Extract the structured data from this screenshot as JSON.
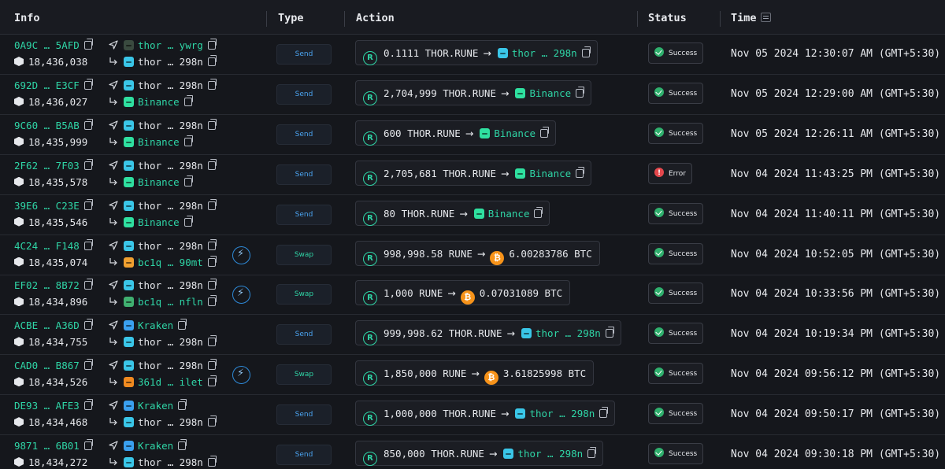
{
  "header": {
    "info": "Info",
    "type": "Type",
    "action": "Action",
    "status": "Status",
    "time": "Time"
  },
  "colors": {
    "accent": "#2fd5a6",
    "send": "#4aa3f0",
    "success": "#2fb06d",
    "error": "#e5484d",
    "btc": "#f7931a"
  },
  "rows": [
    {
      "hash": "0A9C … 5AFD",
      "block": "18,436,038",
      "from": "thor … ywrg",
      "from_color": "#3a4a3f",
      "from_style": "green",
      "to": "thor … 298n",
      "to_color": "#3ac6e8",
      "to_style": "white",
      "swap": false,
      "type": "Send",
      "amount": "0.1111 THOR.RUNE",
      "dest": "thor … 298n",
      "dest_color": "#3ac6e8",
      "dest_kind": "addr",
      "status": "Success",
      "time": "Nov 05 2024 12:30:07 AM (GMT+5:30)"
    },
    {
      "hash": "692D … E3CF",
      "block": "18,436,027",
      "from": "thor … 298n",
      "from_color": "#3ac6e8",
      "from_style": "white",
      "to": "Binance",
      "to_color": "#2fe0a0",
      "to_style": "green",
      "swap": false,
      "type": "Send",
      "amount": "2,704,999 THOR.RUNE",
      "dest": "Binance",
      "dest_color": "#2fe0a0",
      "dest_kind": "addr",
      "status": "Success",
      "time": "Nov 05 2024 12:29:00 AM (GMT+5:30)"
    },
    {
      "hash": "9C60 … B5AB",
      "block": "18,435,999",
      "from": "thor … 298n",
      "from_color": "#3ac6e8",
      "from_style": "white",
      "to": "Binance",
      "to_color": "#2fe0a0",
      "to_style": "green",
      "swap": false,
      "type": "Send",
      "amount": "600 THOR.RUNE",
      "dest": "Binance",
      "dest_color": "#2fe0a0",
      "dest_kind": "addr",
      "status": "Success",
      "time": "Nov 05 2024 12:26:11 AM (GMT+5:30)"
    },
    {
      "hash": "2F62 … 7F03",
      "block": "18,435,578",
      "from": "thor … 298n",
      "from_color": "#3ac6e8",
      "from_style": "white",
      "to": "Binance",
      "to_color": "#2fe0a0",
      "to_style": "green",
      "swap": false,
      "type": "Send",
      "amount": "2,705,681 THOR.RUNE",
      "dest": "Binance",
      "dest_color": "#2fe0a0",
      "dest_kind": "addr",
      "status": "Error",
      "time": "Nov 04 2024 11:43:25 PM (GMT+5:30)"
    },
    {
      "hash": "39E6 … C23E",
      "block": "18,435,546",
      "from": "thor … 298n",
      "from_color": "#3ac6e8",
      "from_style": "white",
      "to": "Binance",
      "to_color": "#2fe0a0",
      "to_style": "green",
      "swap": false,
      "type": "Send",
      "amount": "80 THOR.RUNE",
      "dest": "Binance",
      "dest_color": "#2fe0a0",
      "dest_kind": "addr",
      "status": "Success",
      "time": "Nov 04 2024 11:40:11 PM (GMT+5:30)"
    },
    {
      "hash": "4C24 … F148",
      "block": "18,435,074",
      "from": "thor … 298n",
      "from_color": "#3ac6e8",
      "from_style": "white",
      "to": "bc1q … 90mt",
      "to_color": "#f0a030",
      "to_style": "green",
      "swap": true,
      "type": "Swap",
      "amount": "998,998.58 RUNE",
      "dest": "6.00283786 BTC",
      "dest_color": "#f7931a",
      "dest_kind": "btc",
      "status": "Success",
      "time": "Nov 04 2024 10:52:05 PM (GMT+5:30)"
    },
    {
      "hash": "EF02 … 8B72",
      "block": "18,434,896",
      "from": "thor … 298n",
      "from_color": "#3ac6e8",
      "from_style": "white",
      "to": "bc1q … nfln",
      "to_color": "#40b070",
      "to_style": "green",
      "swap": true,
      "type": "Swap",
      "amount": "1,000 RUNE",
      "dest": "0.07031089 BTC",
      "dest_color": "#f7931a",
      "dest_kind": "btc",
      "status": "Success",
      "time": "Nov 04 2024 10:33:56 PM (GMT+5:30)"
    },
    {
      "hash": "ACBE … A36D",
      "block": "18,434,755",
      "from": "Kraken",
      "from_color": "#3aa0f0",
      "from_style": "green",
      "to": "thor … 298n",
      "to_color": "#3ac6e8",
      "to_style": "white",
      "swap": false,
      "type": "Send",
      "amount": "999,998.62 THOR.RUNE",
      "dest": "thor … 298n",
      "dest_color": "#3ac6e8",
      "dest_kind": "addr",
      "status": "Success",
      "time": "Nov 04 2024 10:19:34 PM (GMT+5:30)"
    },
    {
      "hash": "CAD0 … B867",
      "block": "18,434,526",
      "from": "thor … 298n",
      "from_color": "#3ac6e8",
      "from_style": "white",
      "to": "361d … ilet",
      "to_color": "#f08a20",
      "to_style": "green",
      "swap": true,
      "type": "Swap",
      "amount": "1,850,000 RUNE",
      "dest": "3.61825998 BTC",
      "dest_color": "#f7931a",
      "dest_kind": "btc",
      "status": "Success",
      "time": "Nov 04 2024 09:56:12 PM (GMT+5:30)"
    },
    {
      "hash": "DE93 … AFE3",
      "block": "18,434,468",
      "from": "Kraken",
      "from_color": "#3aa0f0",
      "from_style": "green",
      "to": "thor … 298n",
      "to_color": "#3ac6e8",
      "to_style": "white",
      "swap": false,
      "type": "Send",
      "amount": "1,000,000 THOR.RUNE",
      "dest": "thor … 298n",
      "dest_color": "#3ac6e8",
      "dest_kind": "addr",
      "status": "Success",
      "time": "Nov 04 2024 09:50:17 PM (GMT+5:30)"
    },
    {
      "hash": "9871 … 6B01",
      "block": "18,434,272",
      "from": "Kraken",
      "from_color": "#3aa0f0",
      "from_style": "green",
      "to": "thor … 298n",
      "to_color": "#3ac6e8",
      "to_style": "white",
      "swap": false,
      "type": "Send",
      "amount": "850,000 THOR.RUNE",
      "dest": "thor … 298n",
      "dest_color": "#3ac6e8",
      "dest_kind": "addr",
      "status": "Success",
      "time": "Nov 04 2024 09:30:18 PM (GMT+5:30)"
    }
  ]
}
